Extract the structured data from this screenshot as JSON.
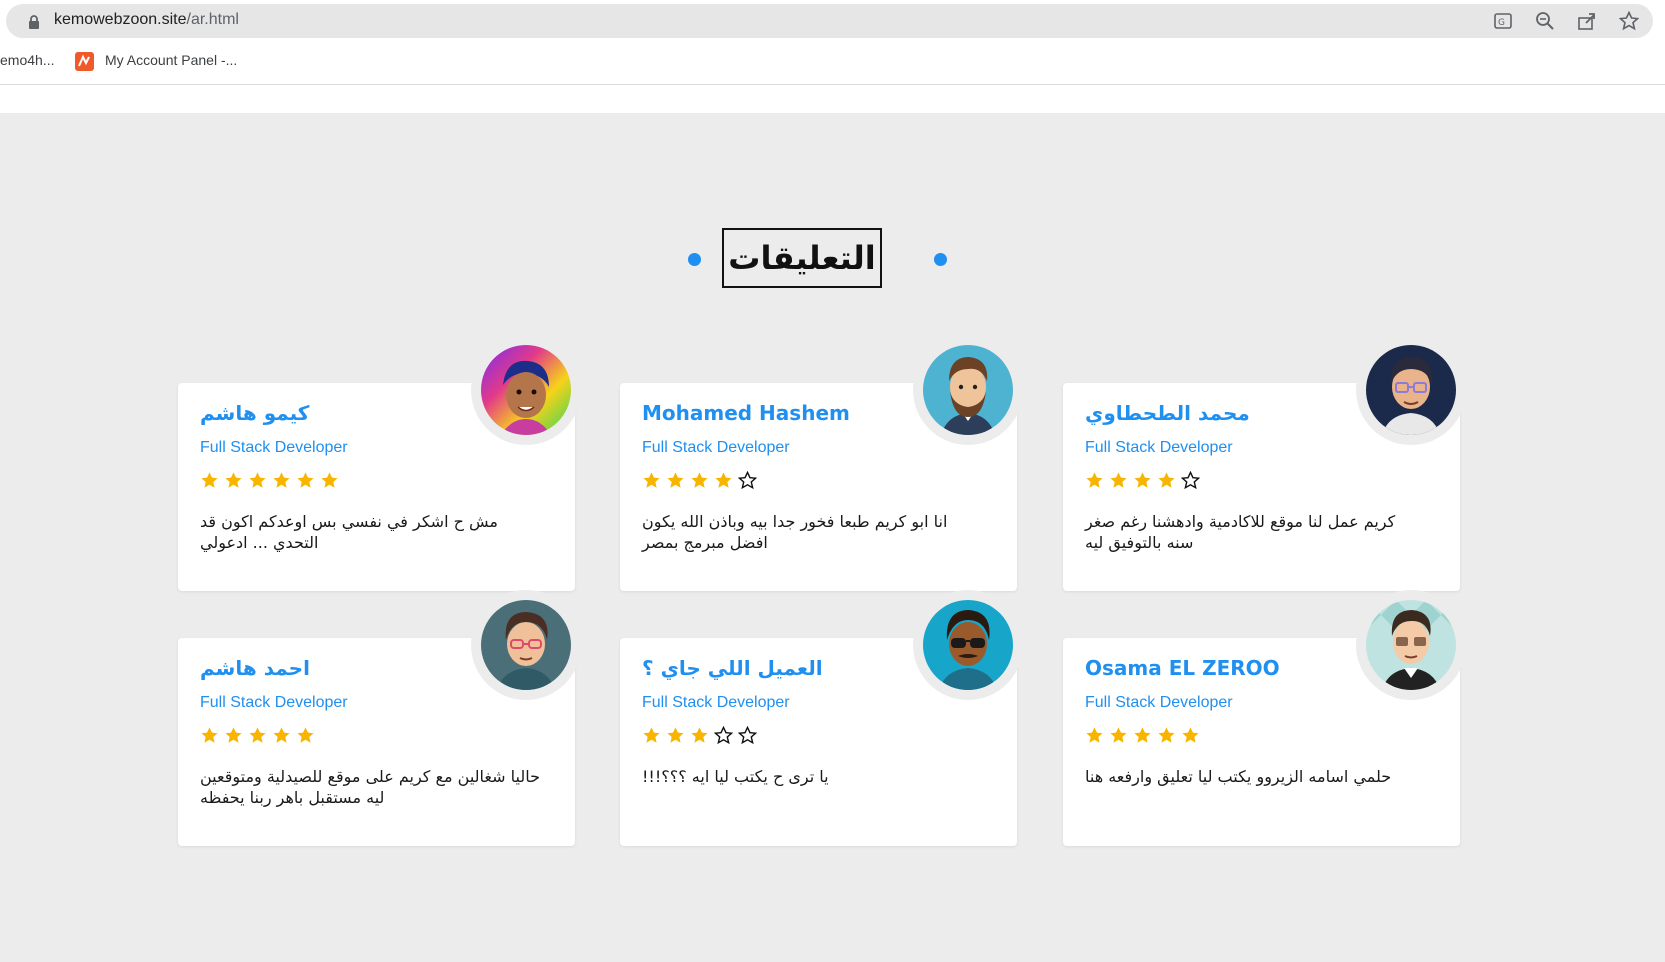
{
  "browser": {
    "url_domain": "kemowebzoon.site",
    "url_path": "/ar.html",
    "bookmarks": [
      {
        "label": "emo4h..."
      },
      {
        "label": "My Account Panel -..."
      }
    ]
  },
  "section": {
    "title": "التعليقات"
  },
  "colors": {
    "accent": "#1f8ff0",
    "star": "#f7b500",
    "background": "#ececec"
  },
  "testimonials": [
    {
      "name": "كيمو هاشم",
      "role": "Full Stack Developer",
      "rating": 6,
      "max": 6,
      "comment": "مش ح اشكر في نفسي بس اوعدكم اكون قد التحدي ... ادعولي"
    },
    {
      "name": "Mohamed Hashem",
      "role": "Full Stack Developer",
      "rating": 4,
      "max": 5,
      "comment": "انا ابو كريم طبعا فخور جدا بيه وباذن الله يكون افضل مبرمج بمصر"
    },
    {
      "name": "محمد الطحطاوي",
      "role": "Full Stack Developer",
      "rating": 4,
      "max": 5,
      "comment": "كريم عمل لنا موقع للاكادمية وادهشنا رغم صغر سنه بالتوفيق ليه"
    },
    {
      "name": "احمد هاشم",
      "role": "Full Stack Developer",
      "rating": 5,
      "max": 5,
      "comment": "حاليا شغالين مع كريم على موقع للصيدلية ومتوقعين ليه مستقبل باهر ربنا يحفظه"
    },
    {
      "name": "العميل اللي جاي ؟",
      "role": "Full Stack Developer",
      "rating": 3,
      "max": 5,
      "comment": "يا ترى ح يكتب ليا ايه ؟؟؟!!!"
    },
    {
      "name": "Osama EL ZEROO",
      "role": "Full Stack Developer",
      "rating": 5,
      "max": 5,
      "comment": "حلمي اسامه الزيروو يكتب ليا تعليق وارفعه هنا"
    }
  ]
}
